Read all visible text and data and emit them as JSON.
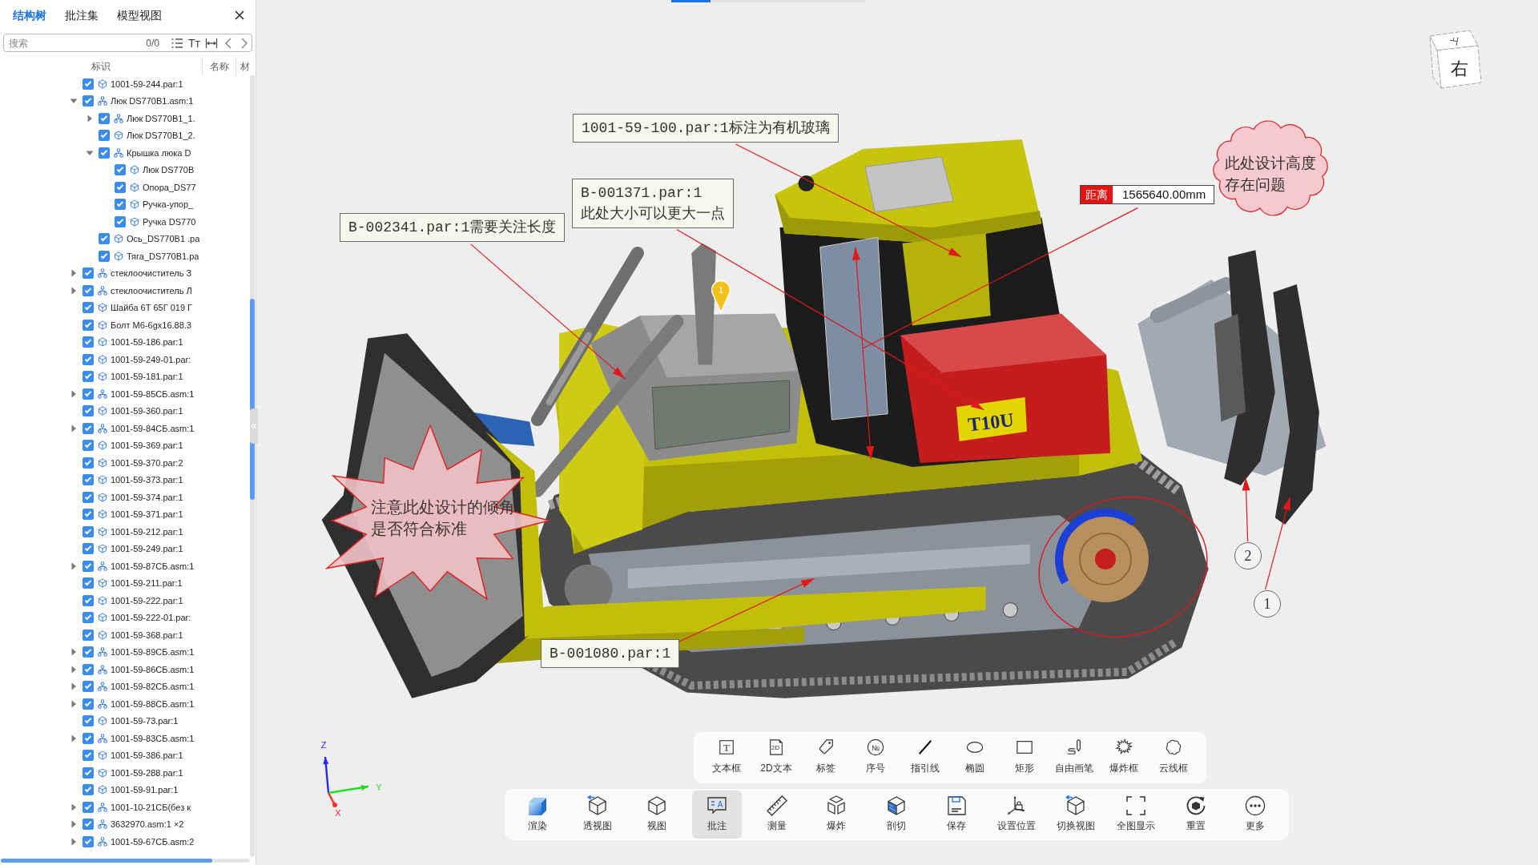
{
  "panel": {
    "tabs": [
      {
        "label": "结构树",
        "selected": true
      },
      {
        "label": "批注集",
        "selected": false
      },
      {
        "label": "模型视图",
        "selected": false
      }
    ],
    "search": {
      "placeholder": "搜索",
      "count": "0/0",
      "case_glyph": "Tт"
    },
    "columns": [
      "标识",
      "名称",
      "材"
    ],
    "tree": [
      {
        "text": "1001-59-244.par:1",
        "kind": "part",
        "checked": true
      },
      {
        "text": "Люк DS770B1.asm:1",
        "kind": "assembly",
        "checked": true,
        "expanded": true,
        "children": [
          {
            "text": "Люк DS770B1_1.",
            "kind": "assembly",
            "checked": true,
            "expanded": false
          },
          {
            "text": "Люк DS770B1_2.",
            "kind": "part",
            "checked": true
          },
          {
            "text": "Крышка люка D",
            "kind": "assembly",
            "checked": true,
            "expanded": true,
            "children": [
              {
                "text": "Люк DS770B",
                "kind": "part",
                "checked": true
              },
              {
                "text": "Опора_DS77",
                "kind": "part",
                "checked": true
              },
              {
                "text": "Ручка-упор_",
                "kind": "part",
                "checked": true
              },
              {
                "text": "Ручка DS770",
                "kind": "part",
                "checked": true
              }
            ]
          },
          {
            "text": "Ось_DS770B1 .pa",
            "kind": "part",
            "checked": true
          },
          {
            "text": "Тяга_DS770B1.pa",
            "kind": "part",
            "checked": true
          }
        ]
      },
      {
        "text": "стеклоочиститель З",
        "kind": "assembly",
        "checked": true,
        "expanded": false
      },
      {
        "text": "стеклоочиститель Л",
        "kind": "assembly",
        "checked": true,
        "expanded": false
      },
      {
        "text": "Шайба 6Т 65Г 019 Г",
        "kind": "part",
        "checked": true
      },
      {
        "text": "Болт М6-6gx16.88.3",
        "kind": "part",
        "checked": true
      },
      {
        "text": "1001-59-186.par:1",
        "kind": "part",
        "checked": true
      },
      {
        "text": "1001-59-249-01.par:",
        "kind": "part",
        "checked": true
      },
      {
        "text": "1001-59-181.par:1",
        "kind": "part",
        "checked": true
      },
      {
        "text": "1001-59-85СБ.asm:1",
        "kind": "assembly",
        "checked": true,
        "expanded": false
      },
      {
        "text": "1001-59-360.par:1",
        "kind": "part",
        "checked": true
      },
      {
        "text": "1001-59-84СБ.asm:1",
        "kind": "assembly",
        "checked": true,
        "expanded": false
      },
      {
        "text": "1001-59-369.par:1",
        "kind": "part",
        "checked": true
      },
      {
        "text": "1001-59-370.par:2",
        "kind": "part",
        "checked": true
      },
      {
        "text": "1001-59-373.par:1",
        "kind": "part",
        "checked": true
      },
      {
        "text": "1001-59-374.par:1",
        "kind": "part",
        "checked": true
      },
      {
        "text": "1001-59-371.par:1",
        "kind": "part",
        "checked": true
      },
      {
        "text": "1001-59-212.par:1",
        "kind": "part",
        "checked": true
      },
      {
        "text": "1001-59-249.par:1",
        "kind": "part",
        "checked": true
      },
      {
        "text": "1001-59-87СБ.asm:1",
        "kind": "assembly",
        "checked": true,
        "expanded": false
      },
      {
        "text": "1001-59-211.par:1",
        "kind": "part",
        "checked": true
      },
      {
        "text": "1001-59-222.par:1",
        "kind": "part",
        "checked": true
      },
      {
        "text": "1001-59-222-01.par:",
        "kind": "part",
        "checked": true
      },
      {
        "text": "1001-59-368.par:1",
        "kind": "part",
        "checked": true
      },
      {
        "text": "1001-59-89СБ.asm:1",
        "kind": "assembly",
        "checked": true,
        "expanded": false
      },
      {
        "text": "1001-59-86СБ.asm:1",
        "kind": "assembly",
        "checked": true,
        "expanded": false
      },
      {
        "text": "1001-59-82СБ.asm:1",
        "kind": "assembly",
        "checked": true,
        "expanded": false
      },
      {
        "text": "1001-59-88СБ.asm:1",
        "kind": "assembly",
        "checked": true,
        "expanded": false
      },
      {
        "text": "1001-59-73.par:1",
        "kind": "part",
        "checked": true
      },
      {
        "text": "1001-59-83СБ.asm:1",
        "kind": "assembly",
        "checked": true,
        "expanded": false
      },
      {
        "text": "1001-59-386.par:1",
        "kind": "part",
        "checked": true
      },
      {
        "text": "1001-59-288.par:1",
        "kind": "part",
        "checked": true
      },
      {
        "text": "1001-59-91.par:1",
        "kind": "part",
        "checked": true
      },
      {
        "text": "1001-10-21СБ(без к",
        "kind": "assembly",
        "checked": true,
        "expanded": false
      },
      {
        "text": "3632970.asm:1 ×2",
        "kind": "assembly",
        "checked": true,
        "expanded": false
      },
      {
        "text": "1001-59-67СБ.asm:2",
        "kind": "assembly",
        "checked": true,
        "expanded": false
      }
    ]
  },
  "viewport": {
    "loading": {
      "level": 0.2
    },
    "view_cube": {
      "top": "上",
      "front": "右"
    },
    "model": {
      "plate": "T10U"
    },
    "marker": {
      "text": "1"
    },
    "annotations": [
      {
        "kind": "callout",
        "lines": [
          "1001-59-100.par:1标注为有机玻璃"
        ]
      },
      {
        "kind": "callout",
        "lines": [
          "B-001371.par:1",
          "此处大小可以更大一点"
        ]
      },
      {
        "kind": "callout",
        "lines": [
          "B-002341.par:1需要关注长度"
        ]
      },
      {
        "kind": "cloud",
        "lines": [
          "此处设计高度",
          "存在问题"
        ]
      },
      {
        "kind": "distance",
        "label": "距离",
        "value": "1565640.00mm"
      },
      {
        "kind": "starburst",
        "lines": [
          "注意此处设计的倾角",
          "是否符合标准"
        ]
      },
      {
        "kind": "callout",
        "lines": [
          "B-001080.par:1"
        ]
      },
      {
        "kind": "balloon",
        "text": "2"
      },
      {
        "kind": "balloon",
        "text": "1"
      }
    ],
    "axes": [
      {
        "kind": "z",
        "label": "Z",
        "color": "#2828ff"
      },
      {
        "kind": "y",
        "label": "Y",
        "color": "#22dd22"
      },
      {
        "kind": "x",
        "label": "X",
        "color": "#ff2a2a"
      }
    ]
  },
  "annotation_toolbar": [
    {
      "label": "文本框",
      "kind": "text",
      "glyph": "T"
    },
    {
      "label": "2D文本",
      "kind": "text2d",
      "glyph": "2D"
    },
    {
      "label": "标签",
      "kind": "tag"
    },
    {
      "label": "序号",
      "kind": "number",
      "glyph": "№"
    },
    {
      "label": "指引线",
      "kind": "leader"
    },
    {
      "label": "椭圆",
      "kind": "ellipse"
    },
    {
      "label": "矩形",
      "kind": "rectangle"
    },
    {
      "label": "自由画笔",
      "kind": "pen"
    },
    {
      "label": "爆炸框",
      "kind": "burst"
    },
    {
      "label": "云线框",
      "kind": "cloud"
    }
  ],
  "main_toolbar": [
    {
      "label": "渲染",
      "kind": "render",
      "selected": false
    },
    {
      "label": "透视图",
      "kind": "perspective",
      "selected": false
    },
    {
      "label": "视图",
      "kind": "view",
      "selected": false
    },
    {
      "label": "批注",
      "kind": "annotate",
      "glyph": "A",
      "selected": true
    },
    {
      "label": "测量",
      "kind": "measure",
      "selected": false
    },
    {
      "label": "爆炸",
      "kind": "explode",
      "selected": false
    },
    {
      "label": "剖切",
      "kind": "section",
      "selected": false
    },
    {
      "label": "保存",
      "kind": "save",
      "selected": false
    },
    {
      "label": "设置位置",
      "kind": "position",
      "selected": false
    },
    {
      "label": "切换视图",
      "kind": "switch",
      "selected": false
    },
    {
      "label": "全图显示",
      "kind": "fit",
      "selected": false
    },
    {
      "label": "重置",
      "kind": "reset",
      "selected": false
    },
    {
      "label": "更多",
      "kind": "more",
      "selected": false
    }
  ]
}
